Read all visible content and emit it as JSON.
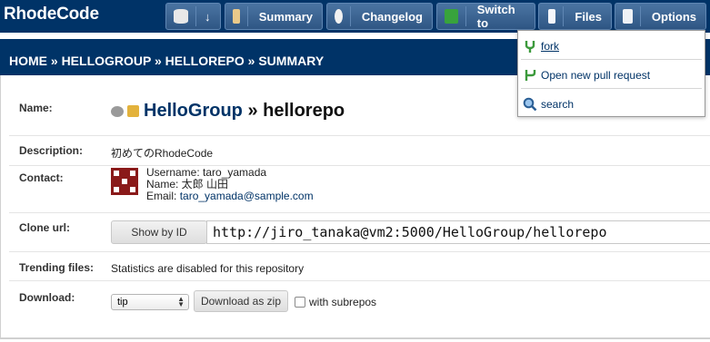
{
  "app": {
    "name": "RhodeCode"
  },
  "toolbar": {
    "download_arrow": "↓",
    "summary_label": "Summary",
    "changelog_label": "Changelog",
    "switch_label": "Switch to",
    "files_label": "Files",
    "options_label": "Options"
  },
  "breadcrumb": "HOME » HELLOGROUP » HELLOREPO » SUMMARY",
  "repo": {
    "group": "HelloGroup",
    "separator": " » ",
    "name": "hellorepo"
  },
  "fields": {
    "name_label": "Name:",
    "description_label": "Description:",
    "description": "初めてのRhodeCode",
    "contact_label": "Contact:",
    "contact_username": "Username: taro_yamada",
    "contact_name": "Name: 太郎 山田",
    "contact_email_prefix": "Email: ",
    "contact_email": "taro_yamada@sample.com",
    "clone_label": "Clone url:",
    "clone_button": "Show by ID",
    "clone_url": "http://jiro_tanaka@vm2:5000/HelloGroup/hellorepo",
    "trending_label": "Trending files:",
    "trending_value": "Statistics are disabled for this repository",
    "download_label": "Download:",
    "download_selected": "tip",
    "download_button": "Download as zip",
    "subrepos_label": "with subrepos"
  },
  "options_menu": {
    "items": [
      {
        "label": "fork",
        "icon": "fork-icon"
      },
      {
        "label": "Open new pull request",
        "icon": "pull-request-icon"
      },
      {
        "label": "search",
        "icon": "search-icon"
      }
    ]
  },
  "colors": {
    "header_bg": "#003367",
    "link": "#003367",
    "button_bg": "#3d6592"
  }
}
